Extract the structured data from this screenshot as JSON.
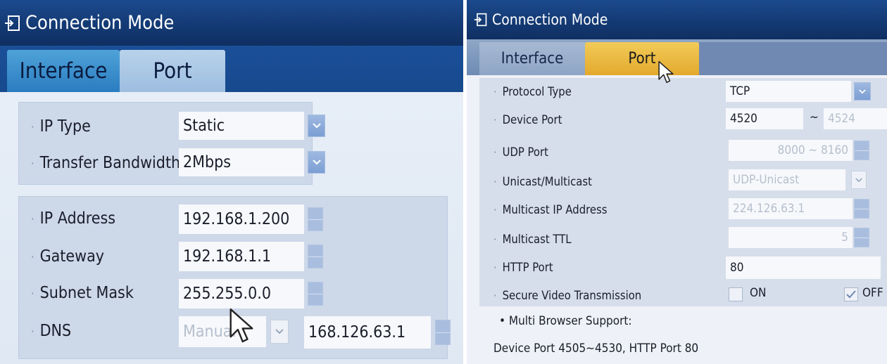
{
  "left_panel": {
    "title": "Connection Mode",
    "tabs": {
      "interface": "Interface",
      "port": "Port"
    },
    "rows": {
      "ip_type": {
        "label": "IP Type",
        "value": "Static"
      },
      "transfer_bandwidth": {
        "label": "Transfer Bandwidth",
        "value": "2Mbps"
      },
      "ip_address": {
        "label": "IP Address",
        "value": "192.168.1.200"
      },
      "gateway": {
        "label": "Gateway",
        "value": "192.168.1.1"
      },
      "subnet_mask": {
        "label": "Subnet Mask",
        "value": "255.255.0.0"
      },
      "dns": {
        "label": "DNS",
        "mode_value": "Manual",
        "value": "168.126.63.1"
      }
    }
  },
  "right_panel": {
    "title": "Connection Mode",
    "tabs": {
      "interface": "Interface",
      "port": "Port"
    },
    "rows": {
      "protocol_type": {
        "label": "Protocol Type",
        "value": "TCP"
      },
      "device_port": {
        "label": "Device Port",
        "value_start": "4520",
        "separator": "~",
        "value_end": "4524"
      },
      "udp_port": {
        "label": "UDP Port",
        "value": "8000 ~ 8160"
      },
      "unicast_multicast": {
        "label": "Unicast/Multicast",
        "value": "UDP-Unicast"
      },
      "multicast_ip": {
        "label": "Multicast IP Address",
        "value": "224.126.63.1"
      },
      "multicast_ttl": {
        "label": "Multicast TTL",
        "value": "5"
      },
      "http_port": {
        "label": "HTTP Port",
        "value": "80"
      },
      "secure_video": {
        "label": "Secure Video Transmission",
        "on_label": "ON",
        "off_label": "OFF"
      }
    },
    "note": {
      "line1": "• Multi Browser Support:",
      "line2": "Device Port 4505~4530, HTTP Port 80"
    }
  },
  "colors": {
    "title_bar": "#143a74",
    "active_tab_left": "#2a7cc0",
    "active_tab_right": "#e3a92d",
    "dropdown_button": "#7b9ed3"
  },
  "icons": {
    "title": "login-icon",
    "dropdown": "chevron-down-icon",
    "spinner": "spinner-arrows-icon",
    "cursor": "mouse-pointer-icon"
  }
}
